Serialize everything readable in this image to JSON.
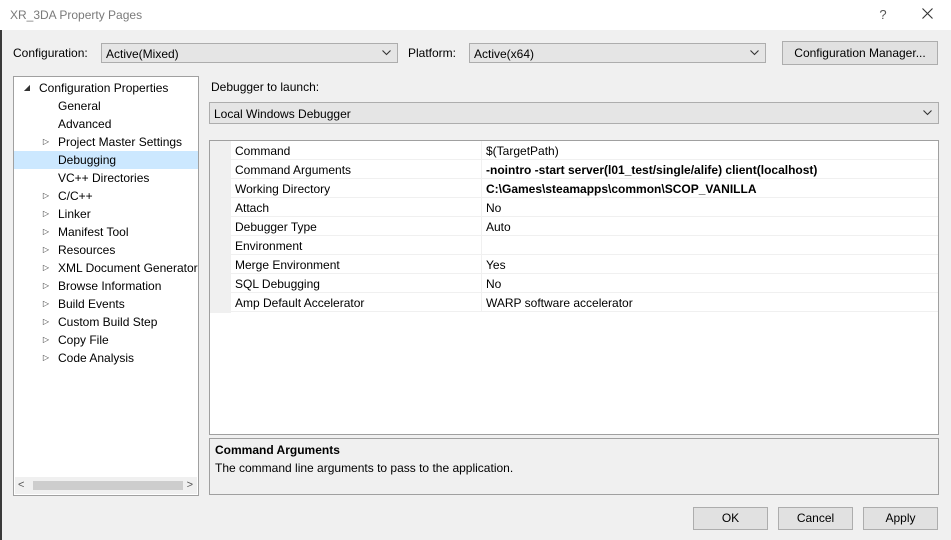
{
  "window": {
    "title": "XR_3DA Property Pages",
    "help_glyph": "?",
    "close_icon": "close-icon"
  },
  "toolbar": {
    "configuration_label": "Configuration:",
    "configuration_value": "Active(Mixed)",
    "platform_label": "Platform:",
    "platform_value": "Active(x64)",
    "config_manager_label": "Configuration Manager..."
  },
  "tree": {
    "items": [
      {
        "label": "Configuration Properties",
        "expander": "expanded",
        "level": 0,
        "selected": false
      },
      {
        "label": "General",
        "expander": "none",
        "level": 1,
        "selected": false
      },
      {
        "label": "Advanced",
        "expander": "none",
        "level": 1,
        "selected": false
      },
      {
        "label": "Project Master Settings",
        "expander": "collapsed",
        "level": 1,
        "selected": false
      },
      {
        "label": "Debugging",
        "expander": "none",
        "level": 1,
        "selected": true
      },
      {
        "label": "VC++ Directories",
        "expander": "none",
        "level": 1,
        "selected": false
      },
      {
        "label": "C/C++",
        "expander": "collapsed",
        "level": 1,
        "selected": false
      },
      {
        "label": "Linker",
        "expander": "collapsed",
        "level": 1,
        "selected": false
      },
      {
        "label": "Manifest Tool",
        "expander": "collapsed",
        "level": 1,
        "selected": false
      },
      {
        "label": "Resources",
        "expander": "collapsed",
        "level": 1,
        "selected": false
      },
      {
        "label": "XML Document Generator",
        "expander": "collapsed",
        "level": 1,
        "selected": false
      },
      {
        "label": "Browse Information",
        "expander": "collapsed",
        "level": 1,
        "selected": false
      },
      {
        "label": "Build Events",
        "expander": "collapsed",
        "level": 1,
        "selected": false
      },
      {
        "label": "Custom Build Step",
        "expander": "collapsed",
        "level": 1,
        "selected": false
      },
      {
        "label": "Copy File",
        "expander": "collapsed",
        "level": 1,
        "selected": false
      },
      {
        "label": "Code Analysis",
        "expander": "collapsed",
        "level": 1,
        "selected": false
      }
    ]
  },
  "debugger": {
    "label": "Debugger to launch:",
    "value": "Local Windows Debugger"
  },
  "properties": [
    {
      "name": "Command",
      "value": "$(TargetPath)",
      "bold": false
    },
    {
      "name": "Command Arguments",
      "value": "-nointro -start server(l01_test/single/alife) client(localhost)",
      "bold": true
    },
    {
      "name": "Working Directory",
      "value": "C:\\Games\\steamapps\\common\\SCOP_VANILLA",
      "bold": true
    },
    {
      "name": "Attach",
      "value": "No",
      "bold": false
    },
    {
      "name": "Debugger Type",
      "value": "Auto",
      "bold": false
    },
    {
      "name": "Environment",
      "value": "",
      "bold": false
    },
    {
      "name": "Merge Environment",
      "value": "Yes",
      "bold": false
    },
    {
      "name": "SQL Debugging",
      "value": "No",
      "bold": false
    },
    {
      "name": "Amp Default Accelerator",
      "value": "WARP software accelerator",
      "bold": false
    }
  ],
  "description": {
    "title": "Command Arguments",
    "text": "The command line arguments to pass to the application."
  },
  "buttons": {
    "ok": "OK",
    "cancel": "Cancel",
    "apply": "Apply"
  },
  "scrollbar": {
    "left_glyph": "<",
    "right_glyph": ">"
  }
}
